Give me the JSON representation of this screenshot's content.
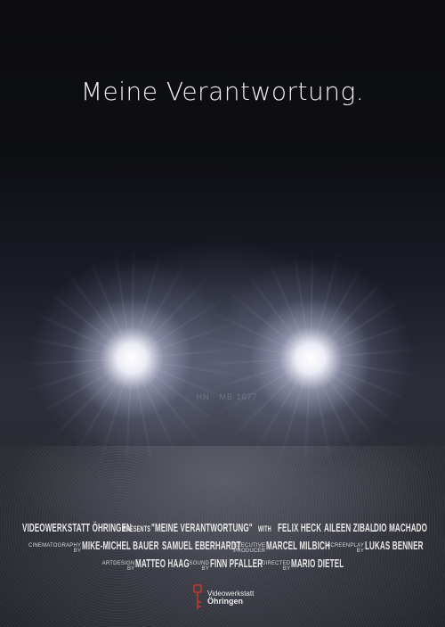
{
  "poster": {
    "title": "Meine Verantwortung.",
    "plate": "HN · MB 1077",
    "credits": {
      "studio": "Videowerkstatt Öhringen",
      "presents": "presents",
      "film_title": "\"Meine Verantwortung\"",
      "with": "with",
      "cast": [
        "Felix Heck",
        "Aileen Zibal",
        "Dio Machado"
      ],
      "cinematography_label": [
        "Cinematography",
        "by"
      ],
      "cinematography": "Mike-Michel Bauer",
      "cinematography_2": "Samuel Eberhardt",
      "exec_label": [
        "Executive",
        "Producer"
      ],
      "exec_producer": "Marcel Milbich",
      "screenplay_label": [
        "Screenplay",
        "by"
      ],
      "screenplay": "Lukas Benner",
      "artdesign_label": [
        "Artdesign",
        "by"
      ],
      "artdesign": "Matteo Haag",
      "sound_label": [
        "Sound",
        "by"
      ],
      "sound": "Finn Pfaller",
      "directed_label": [
        "Directed",
        "by"
      ],
      "director": "Mario Dietel"
    },
    "logo": {
      "line1": "Videowerkstatt",
      "line2": "Öhringen",
      "icon": "key-icon",
      "icon_color": "#c0392b"
    }
  }
}
